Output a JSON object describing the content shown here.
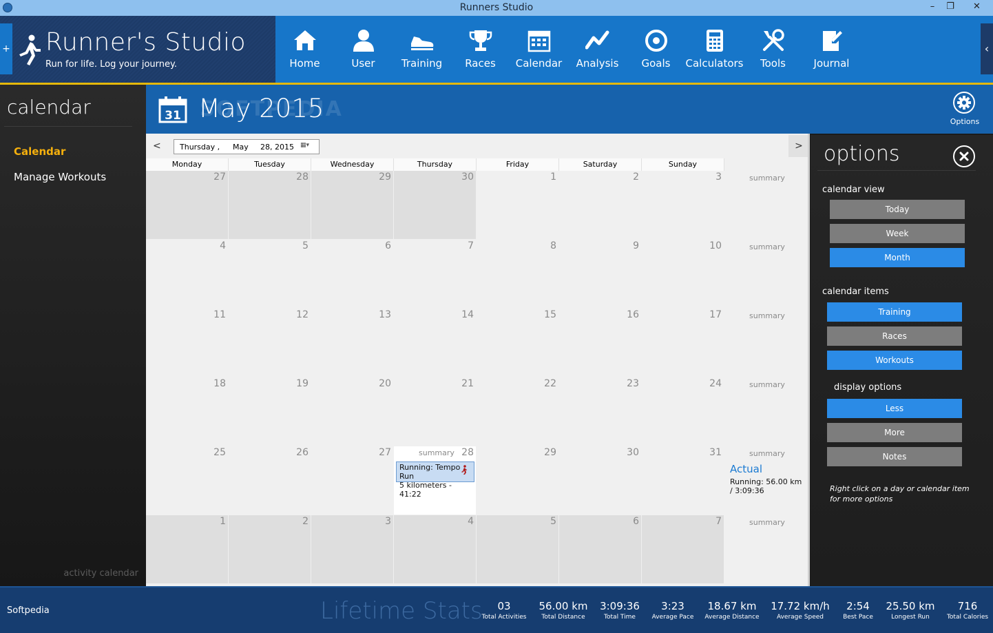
{
  "window": {
    "title": "Runners Studio",
    "minimize": "–",
    "restore": "❐",
    "close": "✕"
  },
  "brand": {
    "name": "Runner's Studio",
    "tagline": "Run for life. Log your journey.",
    "expand_symbol": "+",
    "collapse_symbol": "‹"
  },
  "nav": [
    {
      "label": "Home",
      "icon": "home-icon"
    },
    {
      "label": "User",
      "icon": "user-icon"
    },
    {
      "label": "Training",
      "icon": "shoe-icon"
    },
    {
      "label": "Races",
      "icon": "trophy-icon"
    },
    {
      "label": "Calendar",
      "icon": "calendar-icon"
    },
    {
      "label": "Analysis",
      "icon": "analysis-icon"
    },
    {
      "label": "Goals",
      "icon": "target-icon"
    },
    {
      "label": "Calculators",
      "icon": "calculator-icon"
    },
    {
      "label": "Tools",
      "icon": "tools-icon"
    },
    {
      "label": "Journal",
      "icon": "journal-icon"
    }
  ],
  "left": {
    "heading": "calendar",
    "items": [
      "Calendar",
      "Manage Workouts"
    ],
    "footer": "activity calendar"
  },
  "month": {
    "icon_day": "31",
    "title": "May 2015",
    "watermark": "SOFTPEDIA",
    "options_label": "Options"
  },
  "toolbar": {
    "prev": "<",
    "next": ">",
    "picker_day": "Thursday ,",
    "picker_month": "May",
    "picker_date": "28, 2015",
    "picker_btn": "▦▾"
  },
  "days": [
    "Monday",
    "Tuesday",
    "Wednesday",
    "Thursday",
    "Friday",
    "Saturday",
    "Sunday"
  ],
  "weeks": [
    [
      "27",
      "28",
      "29",
      "30",
      "1",
      "2",
      "3"
    ],
    [
      "4",
      "5",
      "6",
      "7",
      "8",
      "9",
      "10"
    ],
    [
      "11",
      "12",
      "13",
      "14",
      "15",
      "16",
      "17"
    ],
    [
      "18",
      "19",
      "20",
      "21",
      "22",
      "23",
      "24"
    ],
    [
      "25",
      "26",
      "27",
      "28",
      "29",
      "30",
      "31"
    ],
    [
      "1",
      "2",
      "3",
      "4",
      "5",
      "6",
      "7"
    ]
  ],
  "summary_label": "summary",
  "today_summary": "summary",
  "event": {
    "line1": "Running: Tempo Run",
    "line2": "5 kilometers - 41:22"
  },
  "week5_summary": {
    "heading": "Actual",
    "text": "Running: 56.00 km / 3:09:36"
  },
  "options": {
    "title": "options",
    "calendar_view_label": "calendar view",
    "calendar_view": [
      {
        "label": "Today",
        "active": false
      },
      {
        "label": "Week",
        "active": false
      },
      {
        "label": "Month",
        "active": true
      }
    ],
    "calendar_items_label": "calendar items",
    "calendar_items": [
      {
        "label": "Training",
        "active": true
      },
      {
        "label": "Races",
        "active": false
      },
      {
        "label": "Workouts",
        "active": true
      }
    ],
    "display_options_label": "display options",
    "display_options": [
      {
        "label": "Less",
        "active": true
      },
      {
        "label": "More",
        "active": false
      },
      {
        "label": "Notes",
        "active": false
      }
    ],
    "hint": "Right click on a day or calendar item for more options"
  },
  "stats": {
    "left": "Softpedia",
    "heading": "Lifetime Stats",
    "items": [
      {
        "value": "03",
        "label": "Total Activities"
      },
      {
        "value": "56.00 km",
        "label": "Total Distance"
      },
      {
        "value": "3:09:36",
        "label": "Total Time"
      },
      {
        "value": "3:23",
        "label": "Average Pace"
      },
      {
        "value": "18.67 km",
        "label": "Average Distance"
      },
      {
        "value": "17.72 km/h",
        "label": "Average Speed"
      },
      {
        "value": "2:54",
        "label": "Best Pace"
      },
      {
        "value": "25.50 km",
        "label": "Longest Run"
      },
      {
        "value": "716",
        "label": "Total Calories"
      }
    ]
  },
  "colors": {
    "header_blue": "#1776c9",
    "accent_gold": "#e5b80b",
    "active_button": "#2b8be6",
    "inactive_button": "#7d7d7d"
  }
}
